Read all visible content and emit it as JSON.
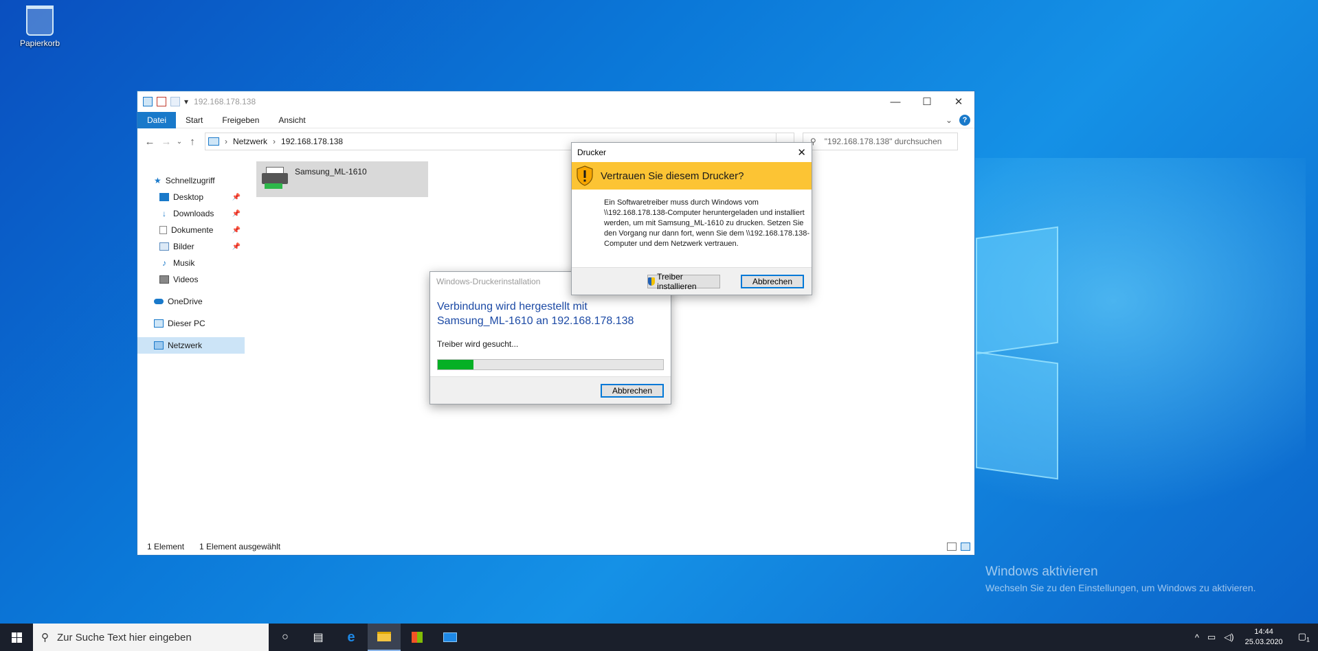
{
  "desktop": {
    "recycle_bin_label": "Papierkorb"
  },
  "watermark": {
    "title": "Windows aktivieren",
    "subtitle": "Wechseln Sie zu den Einstellungen, um Windows zu aktivieren."
  },
  "explorer": {
    "title": "192.168.178.138",
    "ribbon_tabs": [
      "Datei",
      "Start",
      "Freigeben",
      "Ansicht"
    ],
    "help_glyph": "?",
    "address": {
      "segments": [
        "Netzwerk",
        "192.168.178.138"
      ]
    },
    "search_placeholder": "\"192.168.178.138\" durchsuchen",
    "sidebar": {
      "quick_access": "Schnellzugriff",
      "items": [
        {
          "label": "Desktop",
          "icon": "desktop-icon"
        },
        {
          "label": "Downloads",
          "icon": "downloads-icon"
        },
        {
          "label": "Dokumente",
          "icon": "documents-icon"
        },
        {
          "label": "Bilder",
          "icon": "pictures-icon"
        },
        {
          "label": "Musik",
          "icon": "music-icon"
        },
        {
          "label": "Videos",
          "icon": "videos-icon"
        }
      ],
      "onedrive": "OneDrive",
      "this_pc": "Dieser PC",
      "network": "Netzwerk"
    },
    "item": {
      "name": "Samsung_ML-1610"
    },
    "status": {
      "count": "1 Element",
      "selected": "1 Element ausgewählt"
    }
  },
  "install_dialog": {
    "caption": "Windows-Druckerinstallation",
    "heading_line1": "Verbindung wird hergestellt mit",
    "heading_line2": "Samsung_ML-1610 an 192.168.178.138",
    "message": "Treiber wird gesucht...",
    "progress": 0.16,
    "cancel_label": "Abbrechen"
  },
  "trust_dialog": {
    "caption": "Drucker",
    "question": "Vertrauen Sie diesem Drucker?",
    "body": "Ein Softwaretreiber muss durch Windows vom \\\\192.168.178.138-Computer heruntergeladen und installiert werden, um mit Samsung_ML-1610 zu drucken. Setzen Sie den Vorgang nur dann fort, wenn Sie dem \\\\192.168.178.138-Computer und dem Netzwerk vertrauen.",
    "install_label": "Treiber installieren",
    "cancel_label": "Abbrechen"
  },
  "taskbar": {
    "search_placeholder": "Zur Suche Text hier eingeben",
    "time": "14:44",
    "date": "25.03.2020",
    "notification_count": "1"
  },
  "colors": {
    "accent": "#1979ca",
    "warning_banner": "#fcc434",
    "progress": "#06b025",
    "taskbar": "#1a1f2b"
  }
}
